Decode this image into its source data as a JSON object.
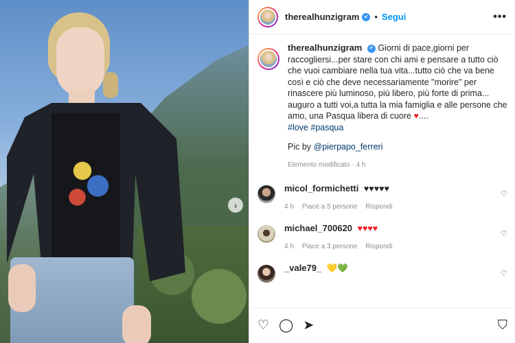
{
  "post": {
    "author": "therealhunzigram",
    "follow_label": "Segui",
    "more_icon": "more-icon",
    "separator": "•",
    "verified_mark": "✔",
    "next_arrow": "›",
    "caption_text": "Giorni di pace,giorni per raccogliersi...per stare con chi ami e pensare a tutto ciò che vuoi cambiare nella tua vita...tutto ciò che va bene così e ciò che deve necessariamente \"morire\" per rinascere più luminoso, più libero, più forte di prima... auguro a tutti voi,a tutta la mia famiglia e alle persone che amo, una Pasqua libera di cuore",
    "caption_heart": "♥",
    "caption_ellipsis": "....",
    "hashtags": [
      "#love",
      "#pasqua"
    ],
    "pic_by_prefix": "Pic by",
    "pic_by_mention": "@pierpapo_ferreri",
    "edited_meta": "Elemento modificato · 4 h"
  },
  "comments": [
    {
      "user": "micol_formichetti",
      "text": "♥♥♥♥♥",
      "time": "4 h",
      "likes": "Piace a 5 persone",
      "reply": "Rispondi"
    },
    {
      "user": "michael_700620",
      "text": "♥♥♥♥",
      "time": "4 h",
      "likes": "Piace a 3 persone",
      "reply": "Rispondi"
    },
    {
      "user": "_vale79_",
      "text": "💛💚"
    }
  ],
  "actions": {
    "like_icon": "♡",
    "comment_icon": "◯",
    "share_icon": "➤",
    "save_icon": "⛉"
  },
  "colors": {
    "accent": "#0095f6",
    "verified": "#3897f0",
    "heart": "#ed1c24",
    "link": "#00376b"
  }
}
